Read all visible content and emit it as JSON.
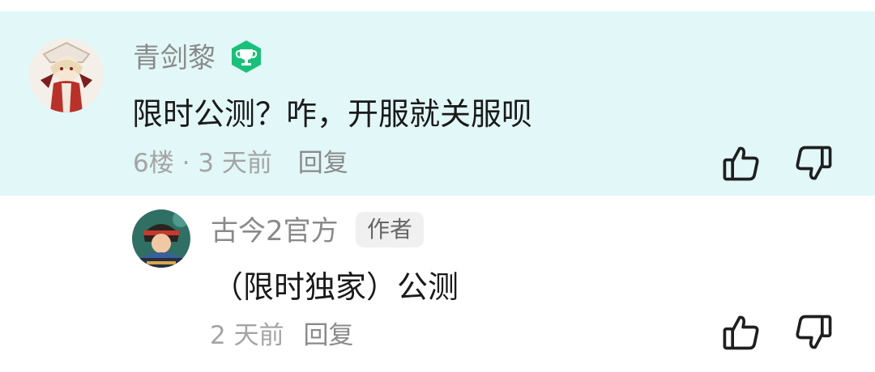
{
  "comment": {
    "username": "青剑黎",
    "badge_icon": "trophy-badge-icon",
    "badge_color": "#19c07a",
    "content": "限时公测？咋，开服就关服呗",
    "floor": "6楼",
    "separator": "·",
    "time": "3 天前",
    "reply_label": "回复",
    "like_icon": "thumbs-up-icon",
    "dislike_icon": "thumbs-down-icon",
    "background": "#e2f7f7"
  },
  "reply": {
    "username": "古今2官方",
    "author_tag": "作者",
    "content": "（限时独家）公测",
    "time": "2 天前",
    "reply_label": "回复",
    "like_icon": "thumbs-up-icon",
    "dislike_icon": "thumbs-down-icon"
  }
}
